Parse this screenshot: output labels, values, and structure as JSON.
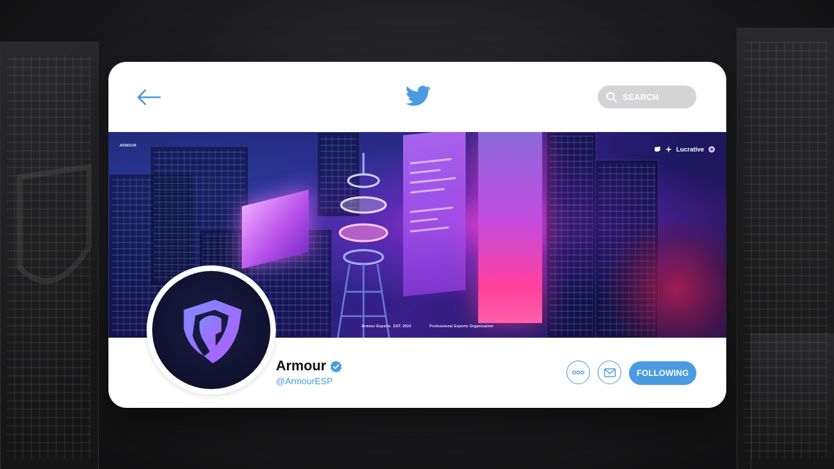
{
  "search": {
    "placeholder": "SEARCH"
  },
  "banner": {
    "watermark": "ARMOUR",
    "sponsor": "Lucrative",
    "caption_left": "Armour Esports",
    "caption_mid": "EST. 2024",
    "caption_right": "Professional Esports Organisation"
  },
  "profile": {
    "name": "Armour",
    "handle": "@ArmourESP",
    "verified": true
  },
  "actions": {
    "follow_label": "FOLLOWING"
  },
  "colors": {
    "accent": "#4a9be0",
    "search_bg": "#d4d4d6",
    "card_bg": "#ffffff"
  },
  "icons": [
    "back-arrow-icon",
    "twitter-bird-icon",
    "search-icon",
    "verified-badge-icon",
    "more-dots-icon",
    "mail-icon",
    "armour-shield-logo"
  ]
}
